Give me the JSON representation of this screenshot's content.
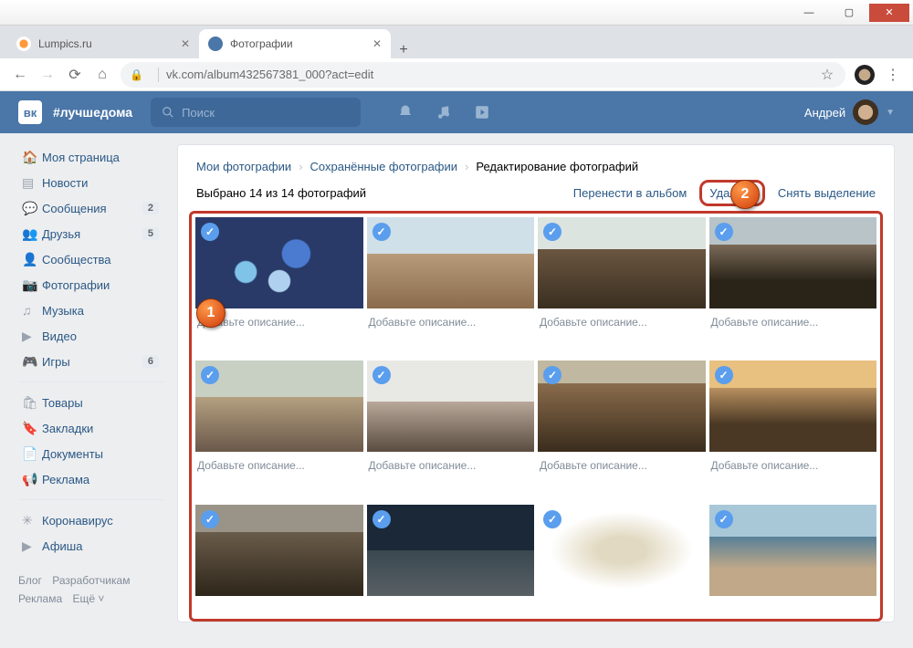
{
  "chrome": {
    "tabs": [
      {
        "title": "Lumpics.ru"
      },
      {
        "title": "Фотографии"
      }
    ],
    "url": "vk.com/album432567381_000?act=edit"
  },
  "vk_header": {
    "hashtag": "#лучшедома",
    "search_placeholder": "Поиск",
    "user_name": "Андрей"
  },
  "sidebar": {
    "items": [
      {
        "label": "Моя страница",
        "icon": "home"
      },
      {
        "label": "Новости",
        "icon": "news"
      },
      {
        "label": "Сообщения",
        "icon": "msg",
        "badge": "2"
      },
      {
        "label": "Друзья",
        "icon": "friends",
        "badge": "5"
      },
      {
        "label": "Сообщества",
        "icon": "groups"
      },
      {
        "label": "Фотографии",
        "icon": "photos"
      },
      {
        "label": "Музыка",
        "icon": "music"
      },
      {
        "label": "Видео",
        "icon": "video"
      },
      {
        "label": "Игры",
        "icon": "games",
        "badge": "6"
      }
    ],
    "items2": [
      {
        "label": "Товары",
        "icon": "market"
      },
      {
        "label": "Закладки",
        "icon": "bookmarks"
      },
      {
        "label": "Документы",
        "icon": "docs"
      },
      {
        "label": "Реклама",
        "icon": "ads"
      }
    ],
    "items3": [
      {
        "label": "Коронавирус",
        "icon": "covid"
      },
      {
        "label": "Афиша",
        "icon": "afisha"
      }
    ],
    "footer": [
      "Блог",
      "Разработчикам",
      "Реклама",
      "Ещё ˅"
    ]
  },
  "breadcrumb": {
    "a": "Мои фотографии",
    "b": "Сохранённые фотографии",
    "c": "Редактирование фотографий"
  },
  "toolbar": {
    "selected_prefix": "Выбрано ",
    "selected_count": "14",
    "selected_mid": " из ",
    "total_count": "14",
    "selected_suffix": " фотографий",
    "move_label": "Перенести в альбом",
    "delete_label": "Удалить",
    "deselect_label": "Снять выделение"
  },
  "photo_desc_placeholder": "Добавьте описание...",
  "callouts": {
    "one": "1",
    "two": "2"
  }
}
